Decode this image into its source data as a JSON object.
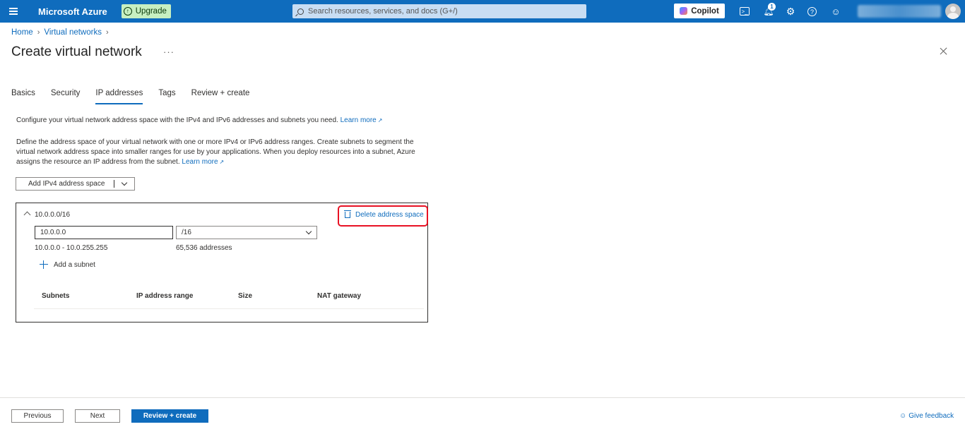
{
  "topbar": {
    "brand": "Microsoft Azure",
    "upgrade_label": "Upgrade",
    "search_placeholder": "Search resources, services, and docs (G+/)",
    "copilot_label": "Copilot",
    "notification_count": "1"
  },
  "breadcrumb": {
    "home": "Home",
    "virtual_networks": "Virtual networks"
  },
  "page": {
    "title": "Create virtual network",
    "more_label": "···"
  },
  "tabs": [
    {
      "label": "Basics"
    },
    {
      "label": "Security"
    },
    {
      "label": "IP addresses"
    },
    {
      "label": "Tags"
    },
    {
      "label": "Review + create"
    }
  ],
  "content": {
    "intro": "Configure your virtual network address space with the IPv4 and IPv6 addresses and subnets you need.",
    "learn_more": "Learn more",
    "define_text": "Define the address space of your virtual network with one or more IPv4 or IPv6 address ranges. Create subnets to segment the virtual network address space into smaller ranges for use by your applications. When you deploy resources into a subnet, Azure assigns the resource an IP address from the subnet.",
    "add_space_label": "Add IPv4 address space"
  },
  "address_space": {
    "label": "10.0.0.0/16",
    "delete_label": "Delete address space",
    "address_value": "10.0.0.0",
    "prefix_value": "/16",
    "range": "10.0.0.0 - 10.0.255.255",
    "count": "65,536 addresses",
    "add_subnet_label": "Add a subnet",
    "columns": [
      "Subnets",
      "IP address range",
      "Size",
      "NAT gateway"
    ]
  },
  "footer": {
    "previous": "Previous",
    "next": "Next",
    "review_create": "Review + create",
    "give_feedback": "Give feedback"
  },
  "colors": {
    "azure_blue": "#0f6cbd",
    "highlight_red": "#e81123",
    "upgrade_green": "#c7f0c1"
  }
}
